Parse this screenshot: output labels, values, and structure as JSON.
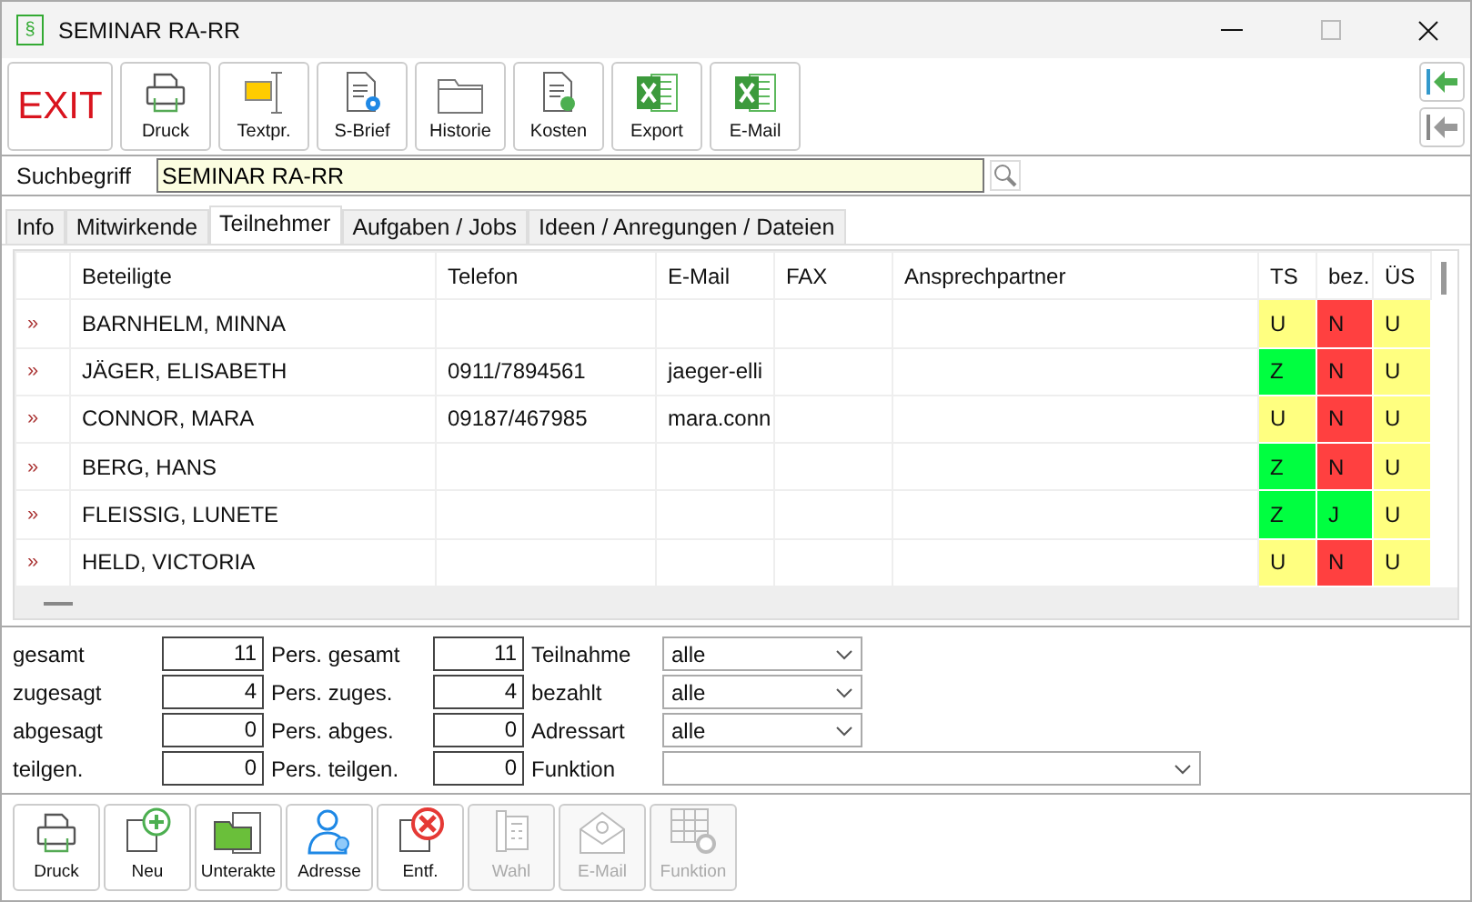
{
  "window": {
    "title": "SEMINAR RA-RR",
    "app_icon": "§"
  },
  "toolbar": [
    {
      "kind": "exit",
      "label": "EXIT"
    },
    {
      "kind": "printer",
      "label": "Druck"
    },
    {
      "kind": "textpr",
      "label": "Textpr."
    },
    {
      "kind": "letter",
      "label": "S-Brief"
    },
    {
      "kind": "folder",
      "label": "Historie"
    },
    {
      "kind": "costs",
      "label": "Kosten"
    },
    {
      "kind": "excel",
      "label": "Export"
    },
    {
      "kind": "excel",
      "label": "E-Mail"
    }
  ],
  "search": {
    "label": "Suchbegriff",
    "value": "SEMINAR RA-RR"
  },
  "tabs": [
    {
      "label": "Info",
      "selected": false
    },
    {
      "label": "Mitwirkende",
      "selected": false
    },
    {
      "label": "Teilnehmer",
      "selected": true
    },
    {
      "label": "Aufgaben / Jobs",
      "selected": false
    },
    {
      "label": "Ideen / Anregungen / Dateien",
      "selected": false
    }
  ],
  "table": {
    "columns": [
      "Beteiligte",
      "Telefon",
      "E-Mail",
      "FAX",
      "Ansprechpartner",
      "TS",
      "bez.",
      "ÜS"
    ],
    "rows": [
      {
        "marker": "»",
        "name": "BARNHELM, MINNA",
        "phone": "",
        "email": "",
        "ts": {
          "text": "U",
          "color": "#ffff80"
        },
        "bez": {
          "text": "N",
          "color": "#ff4040"
        },
        "us": {
          "text": "U",
          "color": "#ffff80"
        }
      },
      {
        "marker": "»",
        "name": "JÄGER, ELISABETH",
        "phone": "0911/7894561",
        "email": "jaeger-elli",
        "ts": {
          "text": "Z",
          "color": "#00ff40"
        },
        "bez": {
          "text": "N",
          "color": "#ff4040"
        },
        "us": {
          "text": "U",
          "color": "#ffff80"
        }
      },
      {
        "marker": "»",
        "name": "CONNOR, MARA",
        "phone": "09187/467985",
        "email": "mara.conn",
        "ts": {
          "text": "U",
          "color": "#ffff80"
        },
        "bez": {
          "text": "N",
          "color": "#ff4040"
        },
        "us": {
          "text": "U",
          "color": "#ffff80"
        }
      },
      {
        "marker": "»",
        "name": "BERG, HANS",
        "phone": "",
        "email": "",
        "ts": {
          "text": "Z",
          "color": "#00ff40"
        },
        "bez": {
          "text": "N",
          "color": "#ff4040"
        },
        "us": {
          "text": "U",
          "color": "#ffff80"
        }
      },
      {
        "marker": "»",
        "name": "FLEISSIG, LUNETE",
        "phone": "",
        "email": "",
        "ts": {
          "text": "Z",
          "color": "#00ff40"
        },
        "bez": {
          "text": "J",
          "color": "#00ff40"
        },
        "us": {
          "text": "U",
          "color": "#ffff80"
        }
      },
      {
        "marker": "»",
        "name": "HELD, VICTORIA",
        "phone": "",
        "email": "",
        "ts": {
          "text": "U",
          "color": "#ffff80"
        },
        "bez": {
          "text": "N",
          "color": "#ff4040"
        },
        "us": {
          "text": "U",
          "color": "#ffff80"
        }
      }
    ]
  },
  "summary": [
    {
      "label": "gesamt",
      "value": "11",
      "pers_label": "Pers. gesamt",
      "pers_value": "11",
      "filter_label": "Teilnahme",
      "filter_value": "alle"
    },
    {
      "label": "zugesagt",
      "value": "4",
      "pers_label": "Pers. zuges.",
      "pers_value": "4",
      "filter_label": "bezahlt",
      "filter_value": "alle"
    },
    {
      "label": "abgesagt",
      "value": "0",
      "pers_label": "Pers. abges.",
      "pers_value": "0",
      "filter_label": "Adressart",
      "filter_value": "alle"
    },
    {
      "label": "teilgen.",
      "value": "0",
      "pers_label": "Pers. teilgen.",
      "pers_value": "0",
      "filter_label": "Funktion"
    }
  ],
  "bottom_toolbar": [
    {
      "kind": "printer",
      "label": "Druck",
      "disabled": false
    },
    {
      "kind": "new",
      "label": "Neu",
      "disabled": false
    },
    {
      "kind": "subfolder",
      "label": "Unterakte",
      "disabled": false
    },
    {
      "kind": "person",
      "label": "Adresse",
      "disabled": false
    },
    {
      "kind": "delete",
      "label": "Entf.",
      "disabled": false
    },
    {
      "kind": "phone",
      "label": "Wahl",
      "disabled": true
    },
    {
      "kind": "mail",
      "label": "E-Mail",
      "disabled": true
    },
    {
      "kind": "grid",
      "label": "Funktion",
      "disabled": true
    }
  ]
}
